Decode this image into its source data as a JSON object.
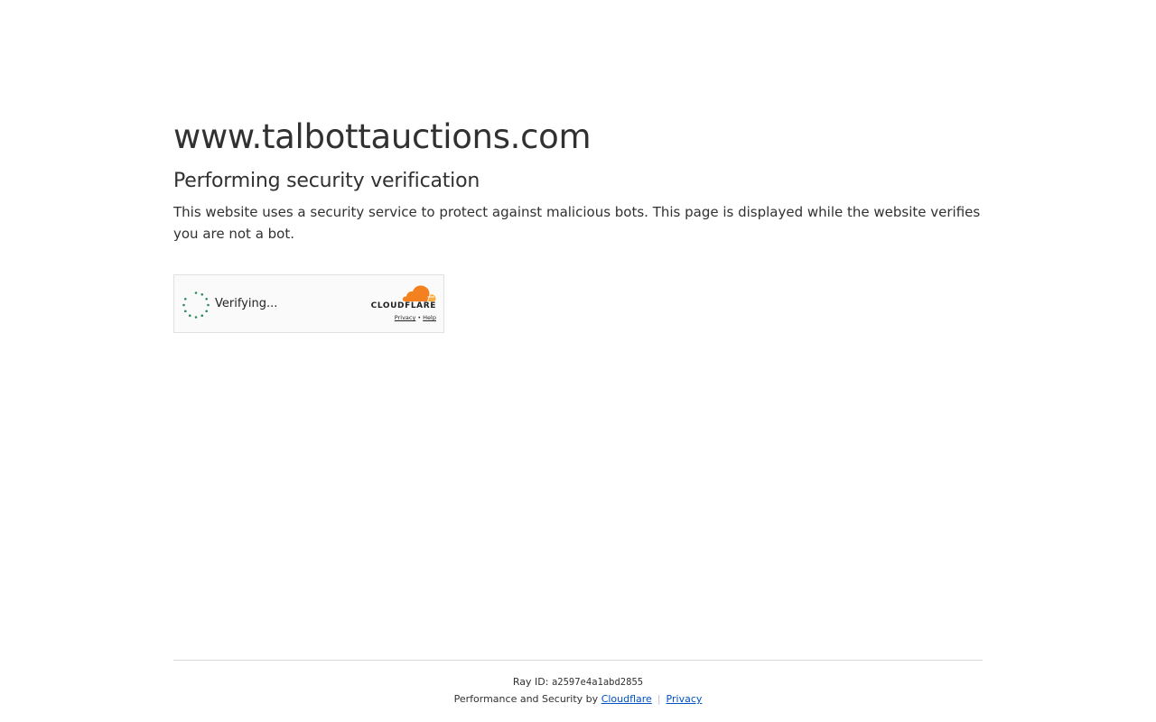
{
  "header": {
    "site_domain": "www.talbottauctions.com",
    "heading": "Performing security verification",
    "description": "This website uses a security service to protect against malicious bots. This page is displayed while the website verifies you are not a bot."
  },
  "challenge_widget": {
    "status_text": "Verifying...",
    "brand_name": "CLOUDFLARE",
    "privacy_link": "Privacy",
    "link_separator": "•",
    "help_link": "Help",
    "icons": {
      "spinner": "loading-spinner-icon",
      "logo": "cloudflare-cloud-icon"
    },
    "colors": {
      "spinner": "#2c8a5c",
      "cloud_orange": "#f48120",
      "cloud_light": "#faad3f"
    }
  },
  "footer": {
    "ray_label": "Ray ID:",
    "ray_id": "a2597e4a1abd2855",
    "perf_text": "Performance and Security by",
    "cloudflare_link": "Cloudflare",
    "separator": "|",
    "privacy_link": "Privacy"
  }
}
